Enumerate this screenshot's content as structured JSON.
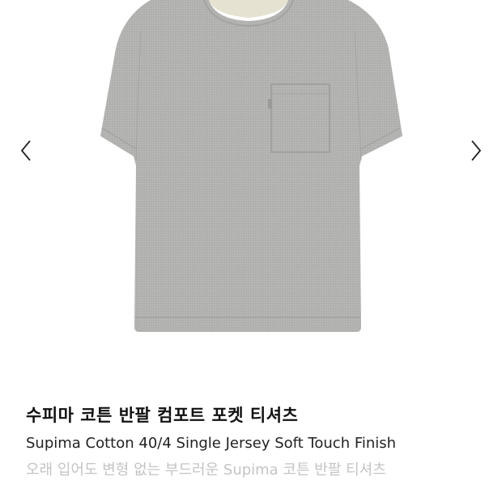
{
  "gallery": {
    "image_name": "gray-pocket-tshirt",
    "prev_icon": "chevron-left-icon",
    "next_icon": "chevron-right-icon"
  },
  "product": {
    "title": "수피마 코튼 반팔 컴포트 포켓 티셔츠",
    "subtitle": "Supima Cotton 40/4 Single Jersey Soft Touch Finish",
    "description": "오래 입어도 변형 없는 부드러운 Supima 코튼 반팔 티셔츠"
  },
  "colors": {
    "shirt": "#b4b4b2",
    "shirt_shadow": "#a6a6a4",
    "collar_inner": "#e6e2d2",
    "arrow": "#222222",
    "title": "#111111",
    "subtitle": "#222222",
    "description": "#c4c4c4"
  }
}
